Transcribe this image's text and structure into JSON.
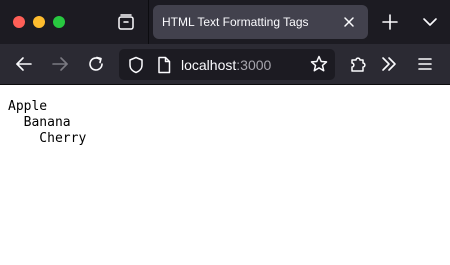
{
  "browser": {
    "tab": {
      "title": "HTML Text Formatting Tags"
    },
    "url": {
      "host": "localhost",
      "port": ":3000"
    }
  },
  "page": {
    "lines": [
      "Apple",
      "  Banana",
      "    Cherry"
    ]
  },
  "icons": {
    "tab_overview": "tabs-overview-icon",
    "tab_close": "close-icon",
    "new_tab": "plus-icon",
    "tab_list": "chevron-down-icon",
    "back": "back-arrow-icon",
    "forward": "forward-arrow-icon",
    "reload": "reload-icon",
    "shield": "shield-icon",
    "page": "page-icon",
    "bookmark": "star-icon",
    "extensions": "puzzle-icon",
    "overflow": "double-chevron-icon",
    "menu": "hamburger-menu-icon"
  },
  "colors": {
    "chrome_dark": "#1c1b22",
    "toolbar": "#2b2a33",
    "active_tab": "#42414d",
    "traffic_close": "#ff5f57",
    "traffic_min": "#febc2e",
    "traffic_max": "#28c840"
  }
}
